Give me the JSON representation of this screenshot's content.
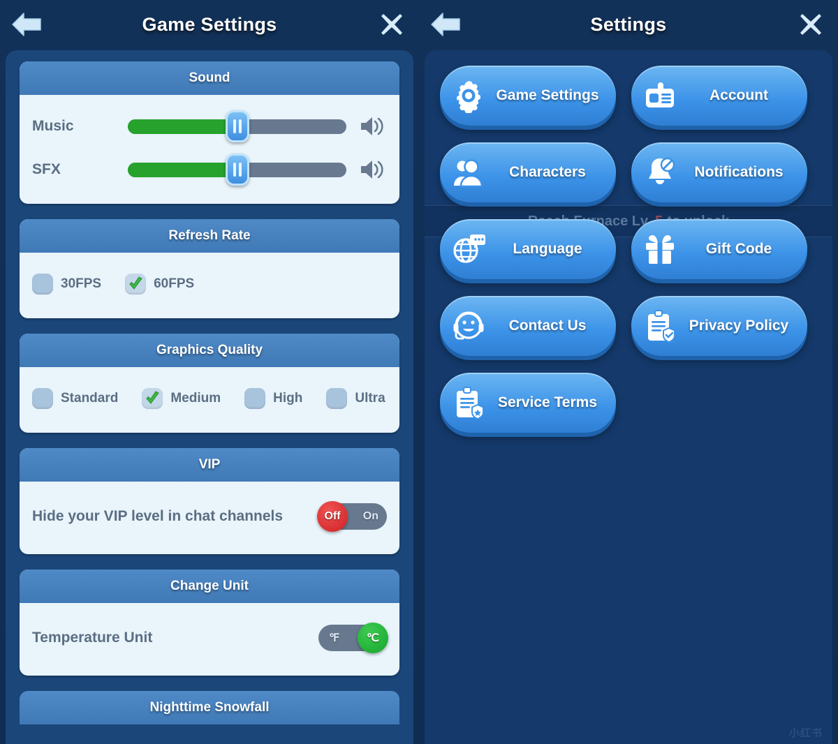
{
  "left_panel": {
    "title": "Game Settings",
    "back_icon": "back-arrow-icon",
    "close_icon": "close-x-icon",
    "sections": {
      "sound": {
        "heading": "Sound",
        "rows": [
          {
            "label": "Music",
            "value": 50,
            "icon": "speaker-icon"
          },
          {
            "label": "SFX",
            "value": 50,
            "icon": "speaker-icon"
          }
        ]
      },
      "refresh_rate": {
        "heading": "Refresh Rate",
        "options": [
          {
            "label": "30FPS",
            "selected": false
          },
          {
            "label": "60FPS",
            "selected": true
          }
        ]
      },
      "graphics_quality": {
        "heading": "Graphics Quality",
        "options": [
          {
            "label": "Standard",
            "selected": false
          },
          {
            "label": "Medium",
            "selected": true
          },
          {
            "label": "High",
            "selected": false
          },
          {
            "label": "Ultra",
            "selected": false
          }
        ]
      },
      "vip": {
        "heading": "VIP",
        "row_label": "Hide your VIP level in chat channels",
        "toggle": {
          "off_label": "Off",
          "on_label": "On",
          "state": "off"
        }
      },
      "change_unit": {
        "heading": "Change Unit",
        "row_label": "Temperature Unit",
        "toggle": {
          "left_label": "℉",
          "right_label": "℃",
          "state": "celsius"
        }
      },
      "nighttime_snowfall": {
        "heading": "Nighttime Snowfall"
      }
    }
  },
  "right_panel": {
    "title": "Settings",
    "back_icon": "back-arrow-icon",
    "close_icon": "close-x-icon",
    "menu": [
      {
        "label": "Game Settings",
        "icon": "gear-icon"
      },
      {
        "label": "Account",
        "icon": "id-card-icon"
      },
      {
        "label": "Characters",
        "icon": "people-icon"
      },
      {
        "label": "Notifications",
        "icon": "bell-slash-icon"
      },
      {
        "label": "Language",
        "icon": "globe-chat-icon"
      },
      {
        "label": "Gift Code",
        "icon": "gift-icon"
      },
      {
        "label": "Contact Us",
        "icon": "headset-smiley-icon"
      },
      {
        "label": "Privacy Policy",
        "icon": "clipboard-check-icon"
      },
      {
        "label": "Service Terms",
        "icon": "clipboard-shield-icon"
      }
    ],
    "unlock_banner": {
      "prefix": "Reach Furnace Lv.",
      "level": "5",
      "suffix": "to unlock"
    },
    "watermark": "小红书"
  },
  "colors": {
    "background": "#123158",
    "panel_left": "#1b4679",
    "panel_right": "#14396a",
    "card_body": "#e9f4fb",
    "card_head": "#4480bd",
    "slider_fill": "#27a22c",
    "slider_track": "#68798f",
    "button_blue": "#3c93e8",
    "toggle_off_red": "#cf2024",
    "toggle_on_green": "#14a52b",
    "check_green": "#3cb843"
  }
}
